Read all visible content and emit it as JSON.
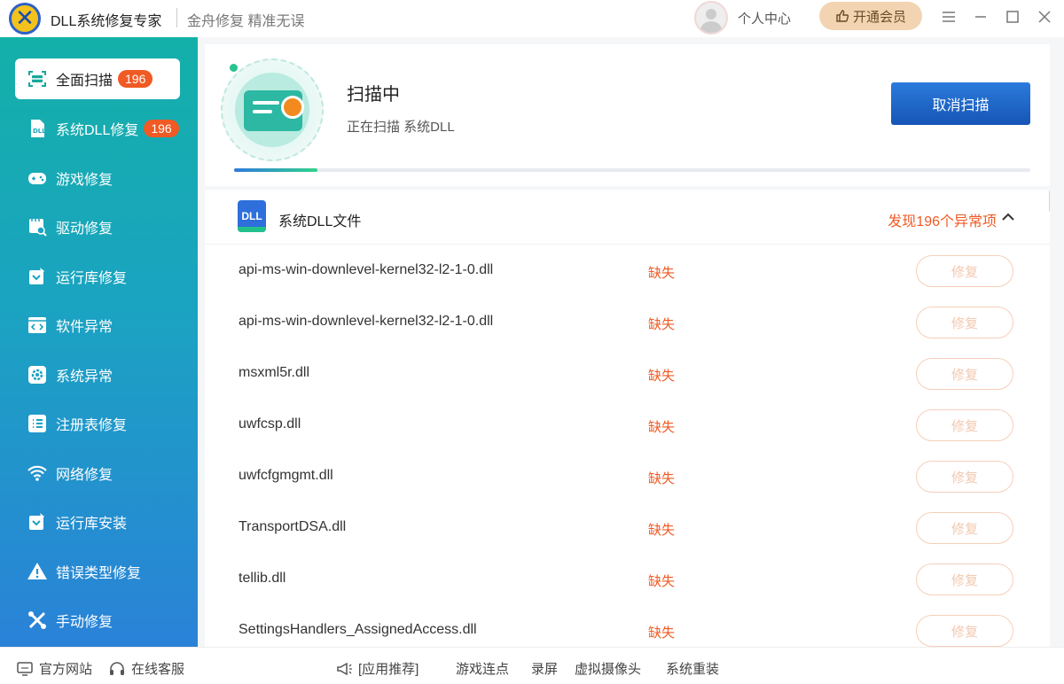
{
  "app": {
    "title": "DLL系统修复专家",
    "slogan": "金舟修复 精准无误",
    "user_center": "个人中心",
    "vip_label": "开通会员"
  },
  "sidebar": {
    "items": [
      {
        "label": "全面扫描",
        "badge": "196",
        "icon": "scan-icon"
      },
      {
        "label": "系统DLL修复",
        "badge": "196",
        "icon": "dll-file-icon"
      },
      {
        "label": "游戏修复",
        "icon": "gamepad-icon"
      },
      {
        "label": "驱动修复",
        "icon": "driver-icon"
      },
      {
        "label": "运行库修复",
        "icon": "runtime-icon"
      },
      {
        "label": "软件异常",
        "icon": "code-window-icon"
      },
      {
        "label": "系统异常",
        "icon": "gear-icon"
      },
      {
        "label": "注册表修复",
        "icon": "list-icon"
      },
      {
        "label": "网络修复",
        "icon": "wifi-icon"
      },
      {
        "label": "运行库安装",
        "icon": "runtime-install-icon"
      },
      {
        "label": "错误类型修复",
        "icon": "warning-icon"
      },
      {
        "label": "手动修复",
        "icon": "tools-icon"
      }
    ]
  },
  "scan": {
    "status": "扫描中",
    "detail": "正在扫描 系统DLL",
    "cancel_label": "取消扫描",
    "progress": 0.105
  },
  "list": {
    "title": "系统DLL文件",
    "found": "发现196个异常项",
    "icon_text": "DLL",
    "rows": [
      {
        "name": "api-ms-win-downlevel-kernel32-l2-1-0.dll",
        "status": "缺失",
        "action": "修复"
      },
      {
        "name": "api-ms-win-downlevel-kernel32-l2-1-0.dll",
        "status": "缺失",
        "action": "修复"
      },
      {
        "name": "msxml5r.dll",
        "status": "缺失",
        "action": "修复"
      },
      {
        "name": "uwfcsp.dll",
        "status": "缺失",
        "action": "修复"
      },
      {
        "name": "uwfcfgmgmt.dll",
        "status": "缺失",
        "action": "修复"
      },
      {
        "name": "TransportDSA.dll",
        "status": "缺失",
        "action": "修复"
      },
      {
        "name": "tellib.dll",
        "status": "缺失",
        "action": "修复"
      },
      {
        "name": "SettingsHandlers_AssignedAccess.dll",
        "status": "缺失",
        "action": "修复"
      }
    ]
  },
  "footer": {
    "website": "官方网站",
    "support": "在线客服",
    "recommend": "[应用推荐]",
    "links": [
      "游戏连点",
      "录屏",
      "虚拟摄像头",
      "系统重装"
    ]
  },
  "colors": {
    "accent_blue": "#1655b5",
    "warning_orange": "#f05a24",
    "sidebar_top": "#13b0a8",
    "sidebar_bottom": "#2a82d8"
  }
}
